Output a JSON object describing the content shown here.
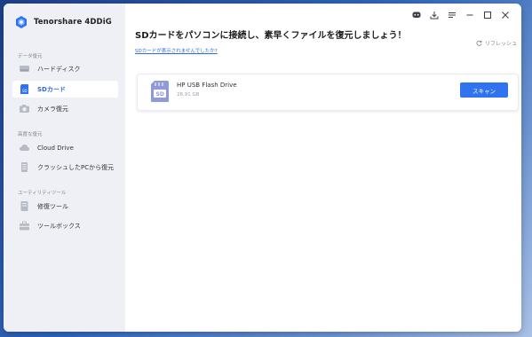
{
  "app": {
    "title": "Tenorshare 4DDiG"
  },
  "sidebar": {
    "sections": [
      {
        "label": "データ復元"
      },
      {
        "label": "高度な復元"
      },
      {
        "label": "ユーティリティツール"
      }
    ],
    "items": [
      {
        "label": "ハードディスク",
        "icon": "hard-disk-icon"
      },
      {
        "label": "SDカード",
        "icon": "sd-card-icon",
        "active": true
      },
      {
        "label": "カメラ復元",
        "icon": "camera-icon"
      },
      {
        "label": "Cloud Drive",
        "icon": "cloud-icon"
      },
      {
        "label": "クラッシュしたPCから復元",
        "icon": "crashed-pc-icon"
      },
      {
        "label": "修復ツール",
        "icon": "repair-icon"
      },
      {
        "label": "ツールボックス",
        "icon": "toolbox-icon"
      }
    ]
  },
  "titlebar": {
    "buttons": [
      "feedback-icon",
      "download-icon",
      "menu-icon",
      "minimize-icon",
      "maximize-icon",
      "close-icon"
    ]
  },
  "main": {
    "title": "SDカードをパソコンに接続し、素早くファイルを復元しましょう！",
    "help_link": "SDカードが表示されませんでしたか?",
    "refresh_label": "リフレッシュ"
  },
  "drive": {
    "name": "HP USB Flash Drive",
    "size": "28.91 GB",
    "scan_label": "スキャン"
  },
  "colors": {
    "accent": "#2f73ee",
    "sidebar_bg": "#eef0f5"
  }
}
